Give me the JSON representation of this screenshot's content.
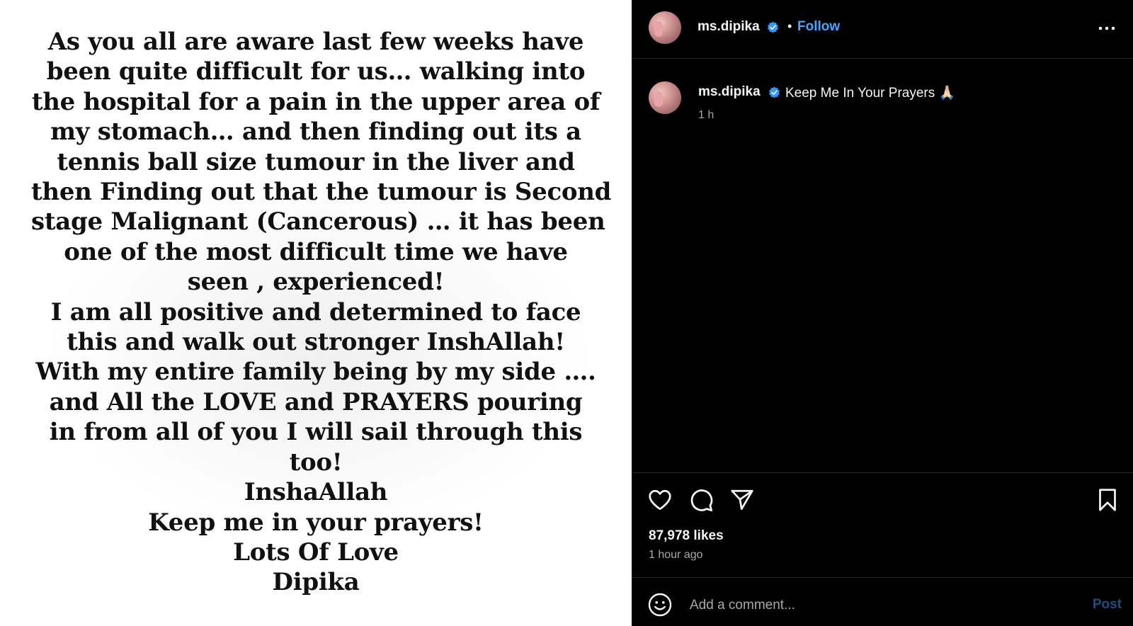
{
  "post": {
    "note_lines": [
      "As you all are aware last few weeks have",
      "been quite difficult for us… walking into",
      "the hospital for a pain in the upper area of",
      "my stomach… and then finding out its a",
      "tennis ball size tumour in the liver and",
      "then Finding out that the tumour is Second",
      "stage Malignant (Cancerous) … it has been",
      "one of the most difficult time we have",
      "seen , experienced!",
      "I am all positive and determined to face",
      "this and walk out stronger InshAllah!",
      "With my entire family being by my side ….",
      "and All the LOVE and PRAYERS pouring",
      "in from all of you I will sail through this",
      "too!",
      "InshaAllah",
      "Keep me in your prayers!",
      "Lots Of Love",
      "Dipika"
    ]
  },
  "header": {
    "username": "ms.dipika",
    "separator": "•",
    "follow_label": "Follow"
  },
  "caption": {
    "username": "ms.dipika",
    "text": "Keep Me In Your Prayers 🙏🏻",
    "time": "1 h"
  },
  "stats": {
    "likes": "87,978 likes",
    "posted": "1 hour ago"
  },
  "comment": {
    "placeholder": "Add a comment...",
    "post_label": "Post"
  },
  "icons": {
    "verified": "verified-badge-icon",
    "more": "more-options-icon",
    "like": "heart-icon",
    "comment": "comment-bubble-icon",
    "share": "paper-plane-icon",
    "save": "bookmark-icon",
    "emoji": "emoji-smile-icon"
  },
  "colors": {
    "verified_blue": "#3897f0",
    "follow_blue": "#4aa3ff",
    "panel_bg": "#000000",
    "muted_text": "#a8a8a8"
  }
}
